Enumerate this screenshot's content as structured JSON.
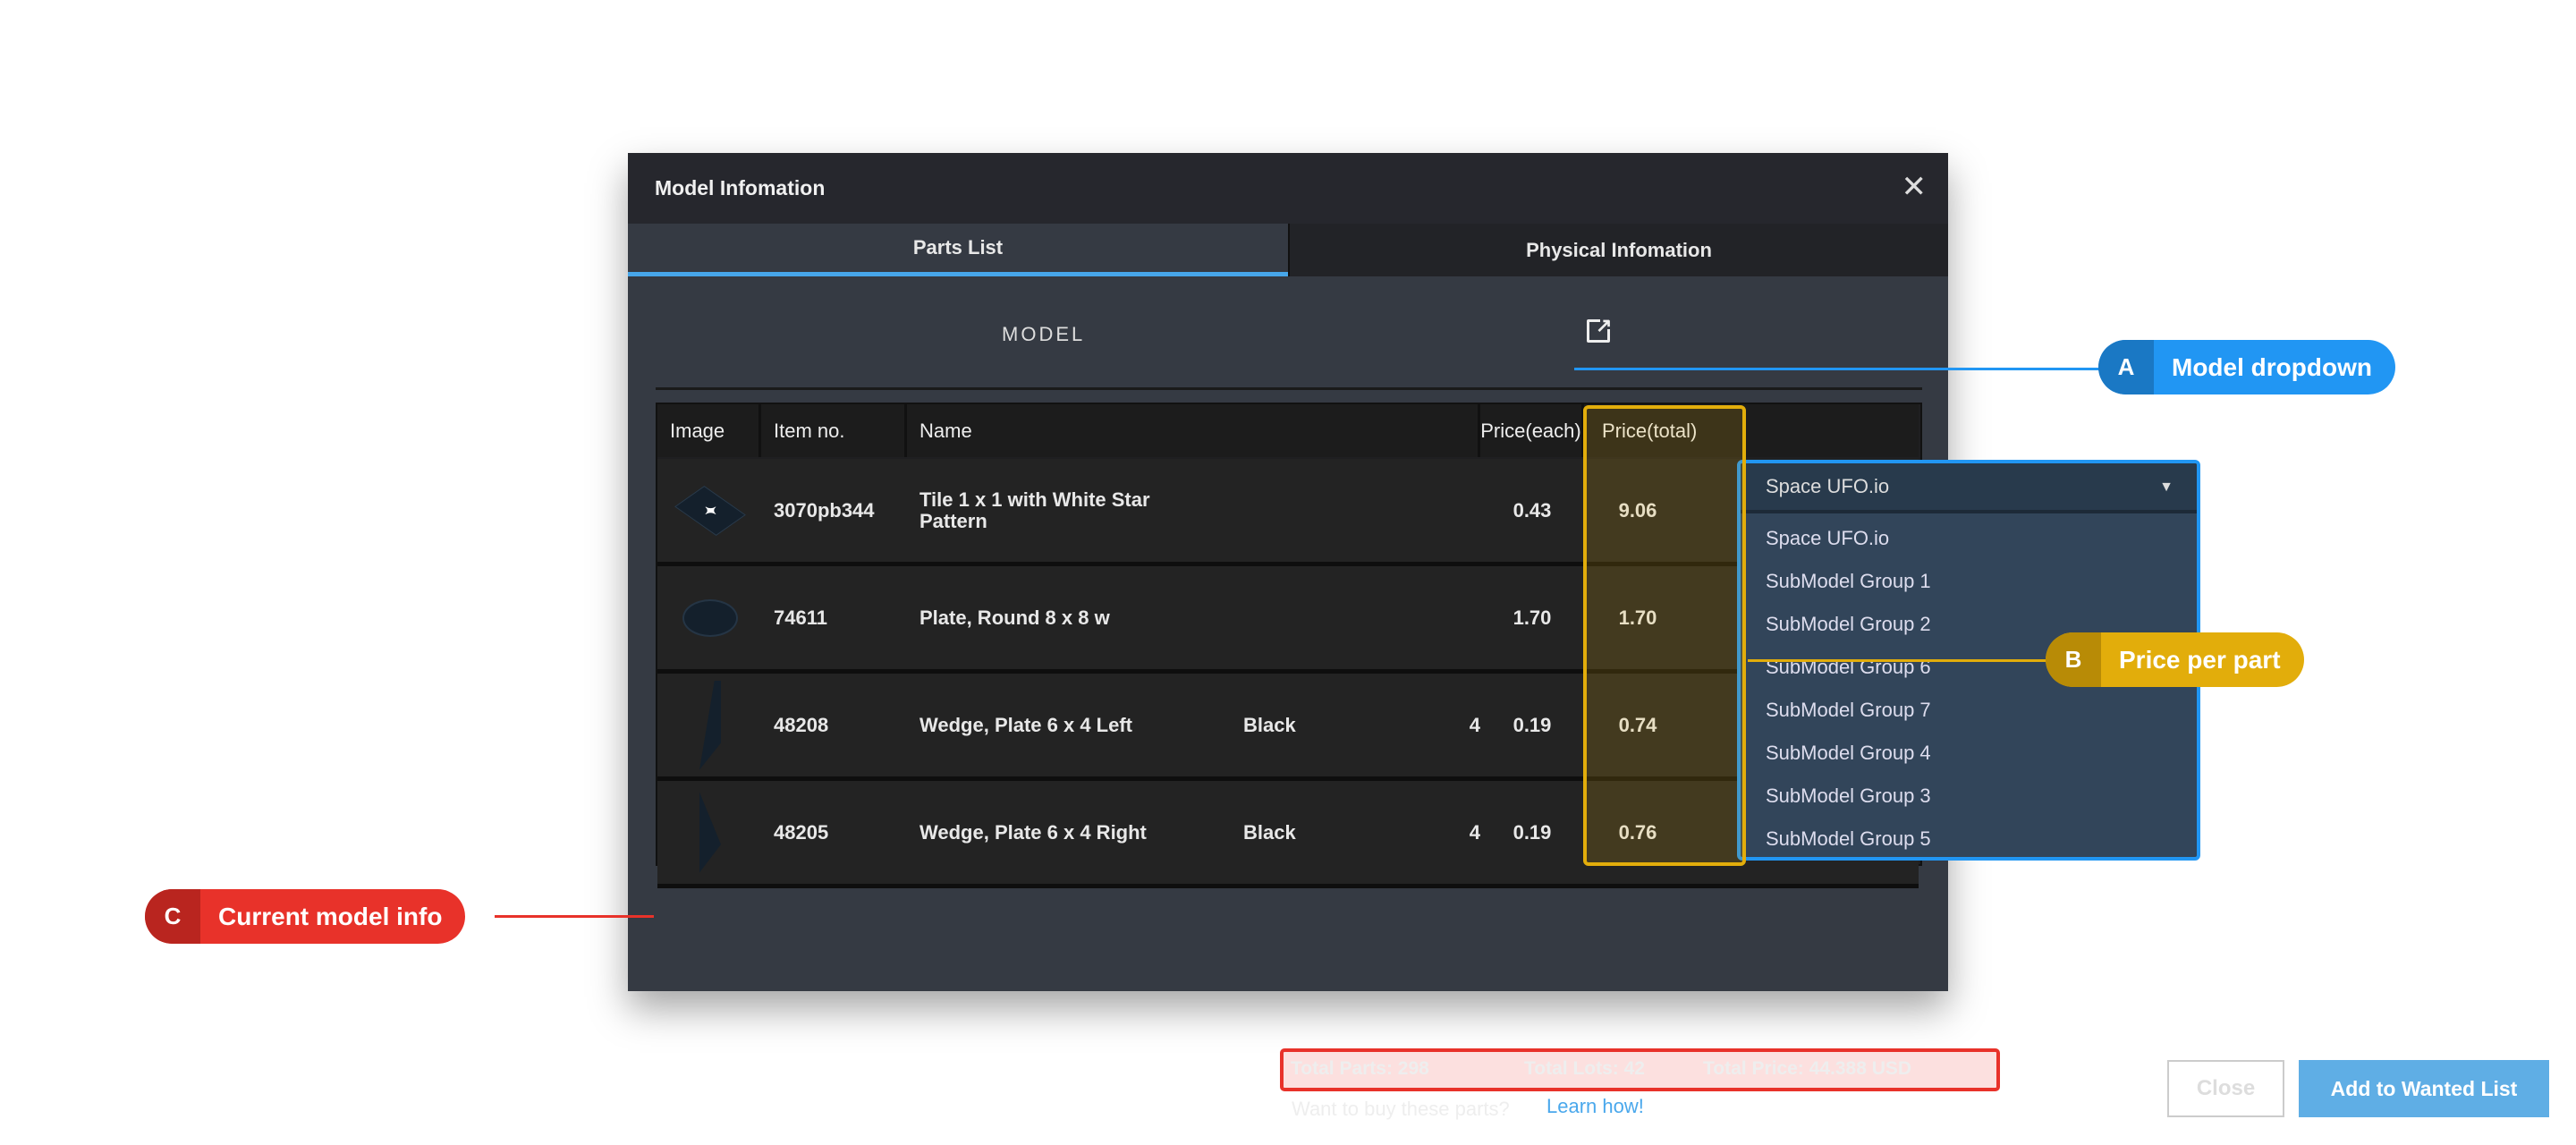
{
  "dialog": {
    "title": "Model Infomation",
    "close_icon": "close-icon",
    "tabs": [
      {
        "label": "Parts List",
        "active": true
      },
      {
        "label": "Physical Infomation",
        "active": false
      }
    ],
    "model_label": "MODEL",
    "model_selected": "Space UFO.io",
    "model_options": [
      "Space UFO.io",
      "SubModel Group 1",
      "SubModel Group 2",
      "SubModel Group 6",
      "SubModel Group 7",
      "SubModel Group 4",
      "SubModel Group 3",
      "SubModel Group 5"
    ],
    "table": {
      "headers": {
        "image": "Image",
        "item": "Item no.",
        "name": "Name",
        "price_each": "Price(each)",
        "price_total": "Price(total)"
      },
      "rows": [
        {
          "item": "3070pb344",
          "name": "Tile 1 x 1 with White Star Pattern",
          "color": "",
          "qty": "",
          "price_each": "0.43",
          "price_total": "9.06"
        },
        {
          "item": "74611",
          "name": "Plate, Round 8 x 8 w",
          "color": "",
          "qty": "",
          "price_each": "1.70",
          "price_total": "1.70"
        },
        {
          "item": "48208",
          "name": "Wedge, Plate 6 x 4 Left",
          "color": "Black",
          "qty": "4",
          "price_each": "0.19",
          "price_total": "0.74"
        },
        {
          "item": "48205",
          "name": "Wedge, Plate 6 x 4 Right",
          "color": "Black",
          "qty": "4",
          "price_each": "0.19",
          "price_total": "0.76"
        }
      ]
    },
    "totals": {
      "parts": "Total Parts: 298",
      "lots": "Total Lots: 42",
      "price": "Total Price: 44.388 USD"
    },
    "buy_prompt": "Want to buy these parts?",
    "learn_link": "Learn how!",
    "close_button": "Close",
    "add_button": "Add to Wanted List"
  },
  "callouts": [
    {
      "letter": "A",
      "label": "Model dropdown",
      "color": "#2196f3",
      "dark": "#1a78c4"
    },
    {
      "letter": "B",
      "label": "Price per part",
      "color": "#e2ad0b",
      "dark": "#b88b06"
    },
    {
      "letter": "C",
      "label": "Current model info",
      "color": "#e8322a",
      "dark": "#b9251f"
    }
  ]
}
